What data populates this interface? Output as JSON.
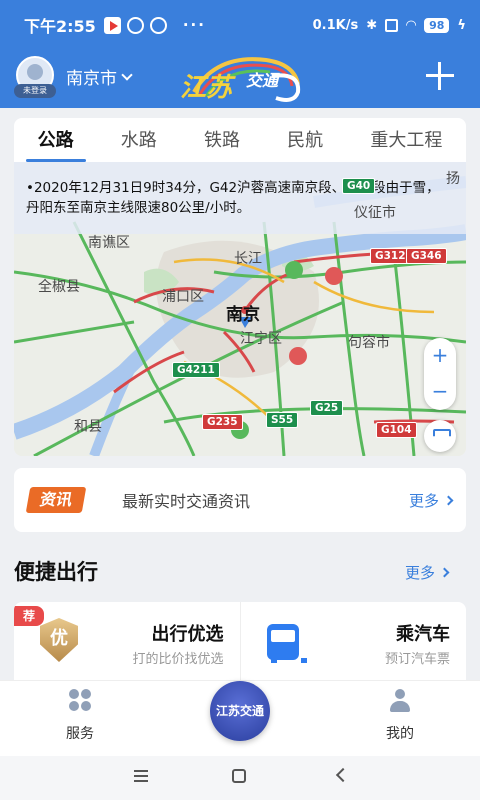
{
  "status_bar": {
    "time": "下午2:55",
    "net_speed": "0.1K/s",
    "battery": "98",
    "more_dots": "···"
  },
  "header": {
    "avatar_tag": "未登录",
    "city": "南京市",
    "logo_text": "江苏交通"
  },
  "traffic": {
    "tabs": [
      {
        "label": "公路"
      },
      {
        "label": "水路"
      },
      {
        "label": "铁路"
      },
      {
        "label": "民航"
      },
      {
        "label": "重大工程"
      }
    ],
    "notice": "•2020年12月31日9时34分，G42沪蓉高速南京段、镇江段由于雪，丹阳东至南京主线限速80公里/小时。",
    "map_labels": {
      "nanjing": "南京",
      "jiangning": "江宁区",
      "pukou": "浦口区",
      "quanjiao": "全椒县",
      "hexian": "和县",
      "jurong": "句容市",
      "changjiang": "长江",
      "yizheng": "仪征市",
      "nanqiao": "南谯区",
      "yang": "扬"
    },
    "shields": {
      "g312": "G312",
      "g346": "G346",
      "g40": "G40",
      "g4211": "G4211",
      "g235": "G235",
      "s55": "S55",
      "g25": "G25",
      "g104": "G104"
    },
    "zoom_in": "+",
    "zoom_out": "−"
  },
  "news": {
    "badge": "资讯",
    "text": "最新实时交通资讯",
    "more": "更多"
  },
  "quick_travel": {
    "title": "便捷出行",
    "more": "更多",
    "cards": [
      {
        "badge": "荐",
        "icon_text": "优",
        "title": "出行优选",
        "subtitle": "打的比价找优选"
      },
      {
        "title": "乘汽车",
        "subtitle": "预订汽车票"
      }
    ]
  },
  "bottom_nav": {
    "service": "服务",
    "center": "江苏交通",
    "mine": "我的"
  },
  "colors": {
    "brand_blue": "#3a7fdc",
    "news_orange": "#ea6b26",
    "recommend_red": "#e84a4a"
  }
}
